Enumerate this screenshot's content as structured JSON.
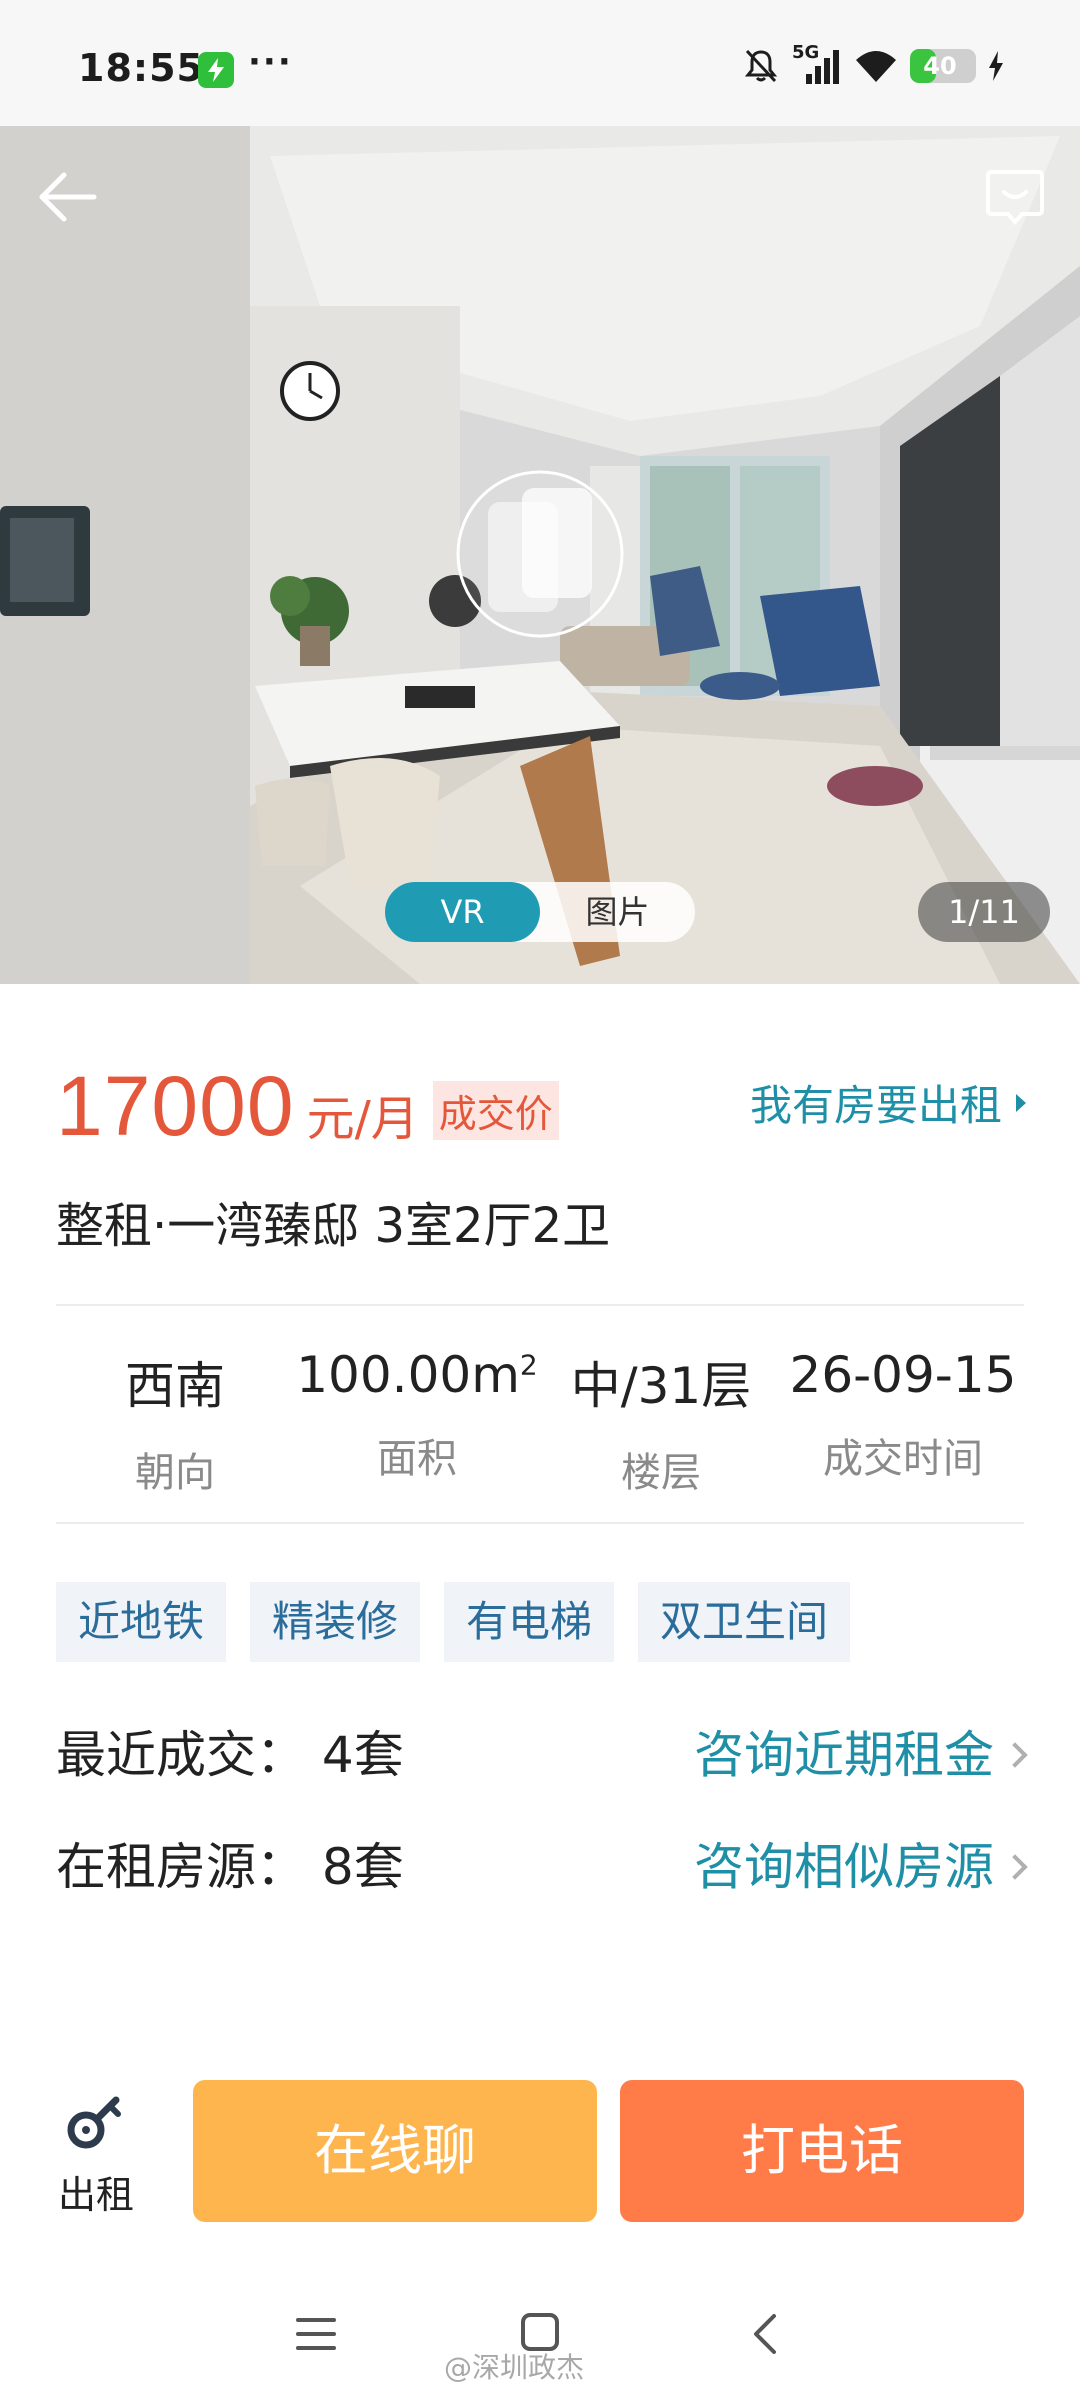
{
  "status_bar": {
    "time": "18:55",
    "dots": "···",
    "network": "5G",
    "battery": "40",
    "battery_level_percent": 40,
    "battery_color": "#3ac43f"
  },
  "hero": {
    "back_icon": "arrow-left-icon",
    "message_icon": "chat-bubble-icon",
    "vr_label": "VR",
    "photo_label": "图片",
    "counter": "1/11"
  },
  "listing": {
    "price": "17000",
    "price_unit": "元/月",
    "deal_badge": "成交价",
    "rent_out_link": "我有房要出租",
    "title": "整租·一湾臻邸 3室2厅2卫",
    "accent_color": "#e4573a",
    "link_color": "#1e8fa6"
  },
  "stats": [
    {
      "value": "西南",
      "label": "朝向"
    },
    {
      "value": "100.00m",
      "sup": "2",
      "label": "面积"
    },
    {
      "value": "中/31层",
      "label": "楼层"
    },
    {
      "value": "26-09-15",
      "label": "成交时间"
    }
  ],
  "tags": [
    "近地铁",
    "精装修",
    "有电梯",
    "双卫生间"
  ],
  "info": {
    "recent_deals_label": "最近成交： 4套",
    "recent_deals_link": "咨询近期租金",
    "on_rent_label": "在租房源： 8套",
    "on_rent_link": "咨询相似房源"
  },
  "actions": {
    "rent_label": "出租",
    "rent_icon": "key-icon",
    "chat_label": "在线聊",
    "call_label": "打电话",
    "chat_color": "#ffb54d",
    "call_color": "#ff7b47"
  },
  "watermark": "@深圳政杰"
}
